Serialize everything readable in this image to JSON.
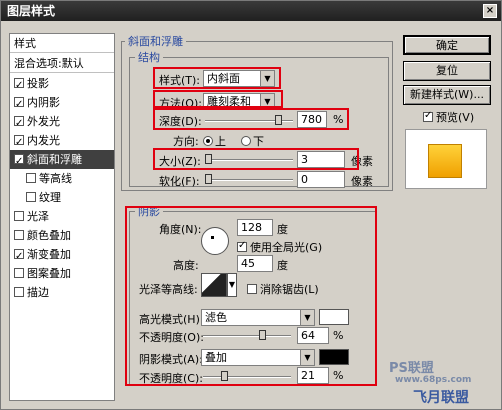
{
  "window": {
    "title": "图层样式",
    "close": "×"
  },
  "left": {
    "header": "样式",
    "blend_default": "混合选项:默认",
    "items": [
      {
        "label": "投影",
        "checked": true
      },
      {
        "label": "内阴影",
        "checked": true
      },
      {
        "label": "外发光",
        "checked": true
      },
      {
        "label": "内发光",
        "checked": true
      },
      {
        "label": "斜面和浮雕",
        "checked": true
      },
      {
        "label": "等高线",
        "checked": false
      },
      {
        "label": "纹理",
        "checked": false
      },
      {
        "label": "光泽",
        "checked": false
      },
      {
        "label": "颜色叠加",
        "checked": false
      },
      {
        "label": "渐变叠加",
        "checked": true
      },
      {
        "label": "图案叠加",
        "checked": false
      },
      {
        "label": "描边",
        "checked": false
      }
    ]
  },
  "bevel": {
    "title": "斜面和浮雕",
    "structure_title": "结构",
    "style_label": "样式(T):",
    "style_value": "内斜面",
    "technique_label": "方法(Q):",
    "technique_value": "雕刻柔和",
    "depth_label": "深度(D):",
    "depth_value": "780",
    "depth_unit": "%",
    "direction_label": "方向:",
    "dir_up": "上",
    "dir_down": "下",
    "size_label": "大小(Z):",
    "size_value": "3",
    "size_unit": "像素",
    "soften_label": "软化(F):",
    "soften_value": "0",
    "soften_unit": "像素"
  },
  "shading": {
    "title": "阴影",
    "angle_label": "角度(N):",
    "angle_value": "128",
    "angle_unit": "度",
    "global_light": "使用全局光(G)",
    "altitude_label": "高度:",
    "altitude_value": "45",
    "altitude_unit": "度",
    "gloss_label": "光泽等高线:",
    "anti_alias": "消除锯齿(L)",
    "highlight_label": "高光模式(H):",
    "highlight_value": "滤色",
    "highlight_color": "#ffffff",
    "hl_opacity_label": "不透明度(O):",
    "hl_opacity_value": "64",
    "shadow_label": "阴影模式(A):",
    "shadow_value": "叠加",
    "shadow_color": "#000000",
    "sh_opacity_label": "不透明度(C):",
    "sh_opacity_value": "21",
    "percent": "%"
  },
  "buttons": {
    "ok": "确定",
    "reset": "复位",
    "new_style": "新建样式(W)...",
    "preview": "预览(V)"
  },
  "watermark": {
    "text1": "PS联盟",
    "text2": "www.68ps.com",
    "brand": "飞月联盟"
  }
}
